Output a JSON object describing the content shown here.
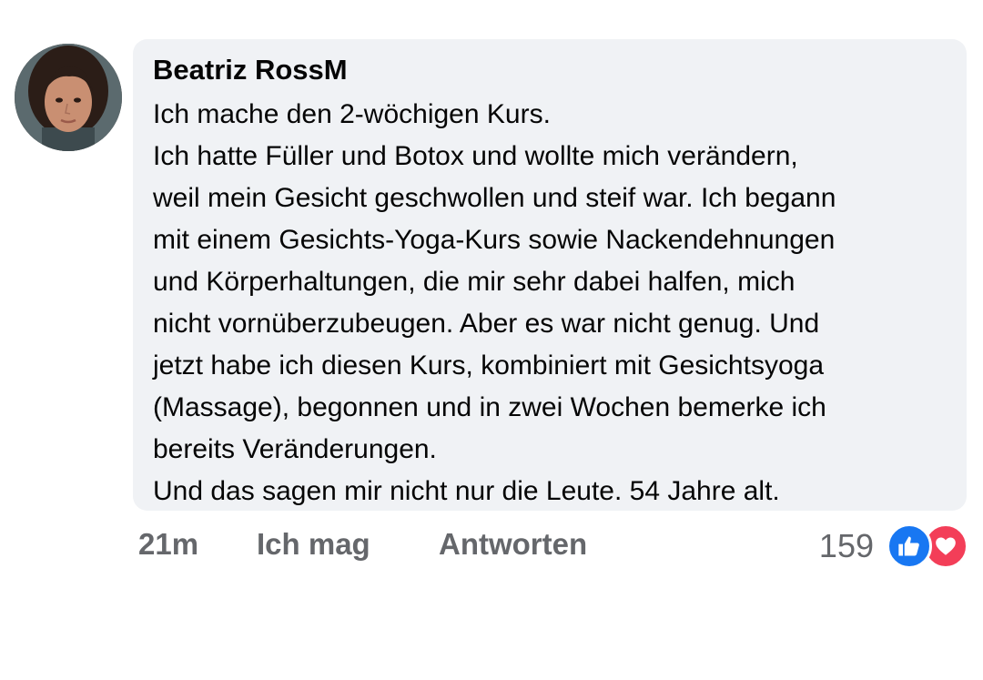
{
  "comment": {
    "author": "Beatriz RossM",
    "lines": [
      "Ich mache den 2-wöchigen Kurs.",
      "Ich hatte Füller und Botox und wollte mich verändern,",
      "weil mein Gesicht geschwollen und steif war. Ich begann",
      "mit einem Gesichts-Yoga-Kurs sowie Nackendehnungen",
      "und Körperhaltungen, die mir sehr dabei halfen, mich",
      "nicht vornüberzubeugen. Aber es war nicht genug. Und",
      "jetzt habe ich diesen Kurs, kombiniert mit Gesichtsyoga",
      "(Massage), begonnen und in zwei Wochen bemerke ich",
      "bereits Veränderungen.",
      "Und das sagen mir nicht nur die Leute. 54 Jahre alt."
    ]
  },
  "actions": {
    "time": "21m",
    "like_label": "Ich mag",
    "reply_label": "Antworten"
  },
  "reactions": {
    "count": "159",
    "icons": [
      "like-icon",
      "love-icon"
    ],
    "like_color": "#1877f2",
    "love_color": "#f33e58"
  },
  "colors": {
    "bubble": "#f0f2f5",
    "secondary_text": "#65676b"
  }
}
